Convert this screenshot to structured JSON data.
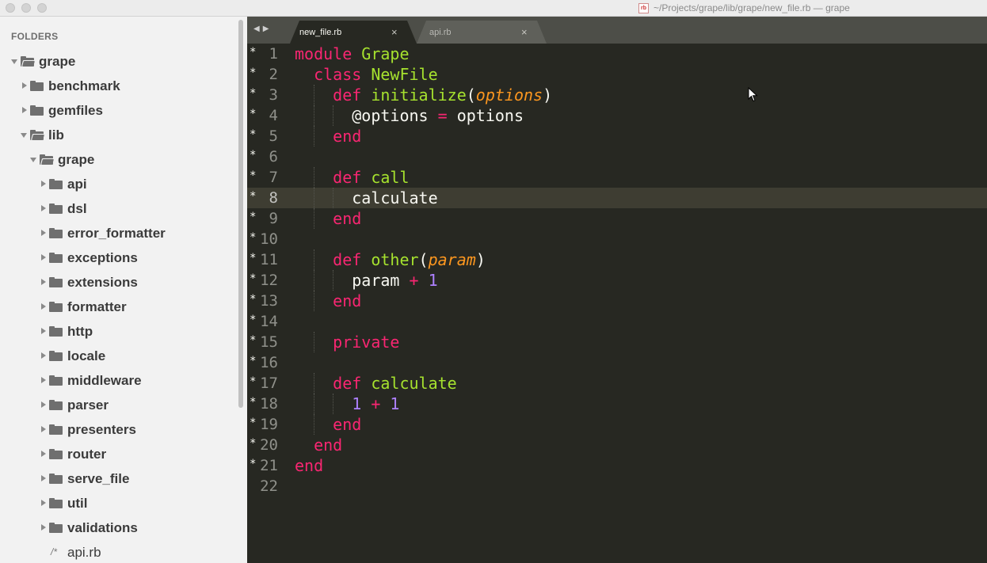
{
  "window": {
    "title": "~/Projects/grape/lib/grape/new_file.rb — grape",
    "file_icon_text": "rb"
  },
  "sidebar": {
    "header": "FOLDERS",
    "items": [
      {
        "label": "grape",
        "type": "folder",
        "expanded": true,
        "depth": 0
      },
      {
        "label": "benchmark",
        "type": "folder",
        "expanded": false,
        "depth": 1
      },
      {
        "label": "gemfiles",
        "type": "folder",
        "expanded": false,
        "depth": 1
      },
      {
        "label": "lib",
        "type": "folder",
        "expanded": true,
        "depth": 1
      },
      {
        "label": "grape",
        "type": "folder",
        "expanded": true,
        "depth": 2
      },
      {
        "label": "api",
        "type": "folder",
        "expanded": false,
        "depth": 3
      },
      {
        "label": "dsl",
        "type": "folder",
        "expanded": false,
        "depth": 3
      },
      {
        "label": "error_formatter",
        "type": "folder",
        "expanded": false,
        "depth": 3
      },
      {
        "label": "exceptions",
        "type": "folder",
        "expanded": false,
        "depth": 3
      },
      {
        "label": "extensions",
        "type": "folder",
        "expanded": false,
        "depth": 3
      },
      {
        "label": "formatter",
        "type": "folder",
        "expanded": false,
        "depth": 3
      },
      {
        "label": "http",
        "type": "folder",
        "expanded": false,
        "depth": 3
      },
      {
        "label": "locale",
        "type": "folder",
        "expanded": false,
        "depth": 3
      },
      {
        "label": "middleware",
        "type": "folder",
        "expanded": false,
        "depth": 3
      },
      {
        "label": "parser",
        "type": "folder",
        "expanded": false,
        "depth": 3
      },
      {
        "label": "presenters",
        "type": "folder",
        "expanded": false,
        "depth": 3
      },
      {
        "label": "router",
        "type": "folder",
        "expanded": false,
        "depth": 3
      },
      {
        "label": "serve_file",
        "type": "folder",
        "expanded": false,
        "depth": 3
      },
      {
        "label": "util",
        "type": "folder",
        "expanded": false,
        "depth": 3
      },
      {
        "label": "validations",
        "type": "folder",
        "expanded": false,
        "depth": 3
      },
      {
        "label": "api.rb",
        "type": "file",
        "depth": 3,
        "icon_text": "/*"
      }
    ]
  },
  "tabs": [
    {
      "label": "new_file.rb",
      "active": true,
      "close": "×"
    },
    {
      "label": "api.rb",
      "active": false,
      "close": "×"
    }
  ],
  "editor": {
    "current_line": 8,
    "modified_marker": "*",
    "lines": [
      [
        {
          "t": "module ",
          "c": "kw"
        },
        {
          "t": "Grape",
          "c": "fn"
        }
      ],
      [
        {
          "t": "class ",
          "c": "kw"
        },
        {
          "t": "NewFile",
          "c": "fn"
        }
      ],
      [
        {
          "t": "def ",
          "c": "kw"
        },
        {
          "t": "initialize",
          "c": "fn"
        },
        {
          "t": "(",
          "c": ""
        },
        {
          "t": "options",
          "c": "par"
        },
        {
          "t": ")",
          "c": ""
        }
      ],
      [
        {
          "t": "@options ",
          "c": ""
        },
        {
          "t": "=",
          "c": "op"
        },
        {
          "t": " options",
          "c": ""
        }
      ],
      [
        {
          "t": "end",
          "c": "kw"
        }
      ],
      [],
      [
        {
          "t": "def ",
          "c": "kw"
        },
        {
          "t": "call",
          "c": "fn"
        }
      ],
      [
        {
          "t": "calculate",
          "c": ""
        }
      ],
      [
        {
          "t": "end",
          "c": "kw"
        }
      ],
      [],
      [
        {
          "t": "def ",
          "c": "kw"
        },
        {
          "t": "other",
          "c": "fn"
        },
        {
          "t": "(",
          "c": ""
        },
        {
          "t": "param",
          "c": "par"
        },
        {
          "t": ")",
          "c": ""
        }
      ],
      [
        {
          "t": "param ",
          "c": ""
        },
        {
          "t": "+",
          "c": "op"
        },
        {
          "t": " ",
          "c": ""
        },
        {
          "t": "1",
          "c": "num"
        }
      ],
      [
        {
          "t": "end",
          "c": "kw"
        }
      ],
      [],
      [
        {
          "t": "private",
          "c": "kw"
        }
      ],
      [],
      [
        {
          "t": "def ",
          "c": "kw"
        },
        {
          "t": "calculate",
          "c": "fn"
        }
      ],
      [
        {
          "t": "1",
          "c": "num"
        },
        {
          "t": " ",
          "c": ""
        },
        {
          "t": "+",
          "c": "op"
        },
        {
          "t": " ",
          "c": ""
        },
        {
          "t": "1",
          "c": "num"
        }
      ],
      [
        {
          "t": "end",
          "c": "kw"
        }
      ],
      [
        {
          "t": "end",
          "c": "kw"
        }
      ],
      [
        {
          "t": "end",
          "c": "kw"
        }
      ],
      []
    ],
    "indents": [
      0,
      1,
      2,
      3,
      2,
      0,
      2,
      3,
      2,
      0,
      2,
      3,
      2,
      0,
      2,
      0,
      2,
      3,
      2,
      1,
      0,
      0
    ],
    "modified_lines": 21
  },
  "colors": {
    "keyword": "#f92672",
    "function": "#a6e22e",
    "parameter": "#fd971f",
    "number": "#ae81ff",
    "background": "#272822",
    "current_line": "#3e3d32"
  }
}
